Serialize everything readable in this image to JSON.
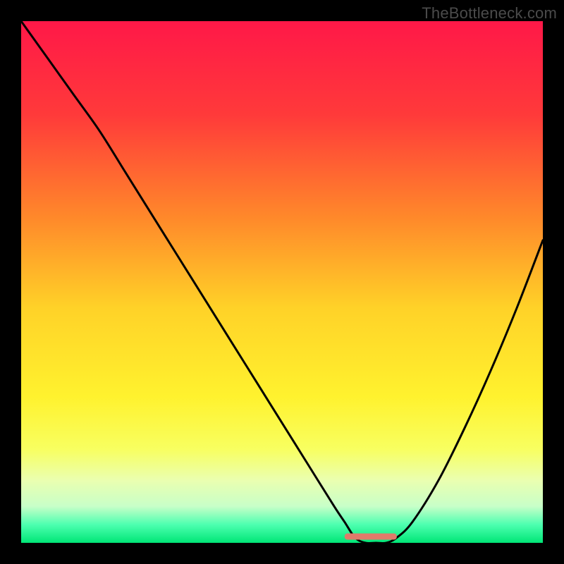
{
  "watermark": "TheBottleneck.com",
  "chart_data": {
    "type": "line",
    "title": "",
    "xlabel": "",
    "ylabel": "",
    "xlim": [
      0,
      100
    ],
    "ylim": [
      0,
      100
    ],
    "grid": false,
    "legend": false,
    "gradient_stops": [
      {
        "offset": 0.0,
        "color": "#ff1848"
      },
      {
        "offset": 0.18,
        "color": "#ff3a3a"
      },
      {
        "offset": 0.38,
        "color": "#ff8a2a"
      },
      {
        "offset": 0.55,
        "color": "#ffd228"
      },
      {
        "offset": 0.72,
        "color": "#fff22e"
      },
      {
        "offset": 0.82,
        "color": "#f8ff60"
      },
      {
        "offset": 0.88,
        "color": "#eaffb0"
      },
      {
        "offset": 0.93,
        "color": "#c8ffc8"
      },
      {
        "offset": 0.965,
        "color": "#4dffb0"
      },
      {
        "offset": 1.0,
        "color": "#00e676"
      }
    ],
    "curve": {
      "x": [
        0,
        5,
        10,
        15,
        20,
        25,
        30,
        35,
        40,
        45,
        50,
        55,
        60,
        62,
        64,
        66,
        68,
        70,
        72,
        75,
        80,
        85,
        90,
        95,
        100
      ],
      "y": [
        100,
        93,
        86,
        79,
        71,
        63,
        55,
        47,
        39,
        31,
        23,
        15,
        7,
        4,
        1,
        0,
        0,
        0,
        1,
        4,
        12,
        22,
        33,
        45,
        58
      ]
    },
    "flat_band": {
      "x_start": 62,
      "x_end": 72,
      "y": 1.2,
      "color": "#e07a6a",
      "thickness_pct": 1.2
    }
  }
}
